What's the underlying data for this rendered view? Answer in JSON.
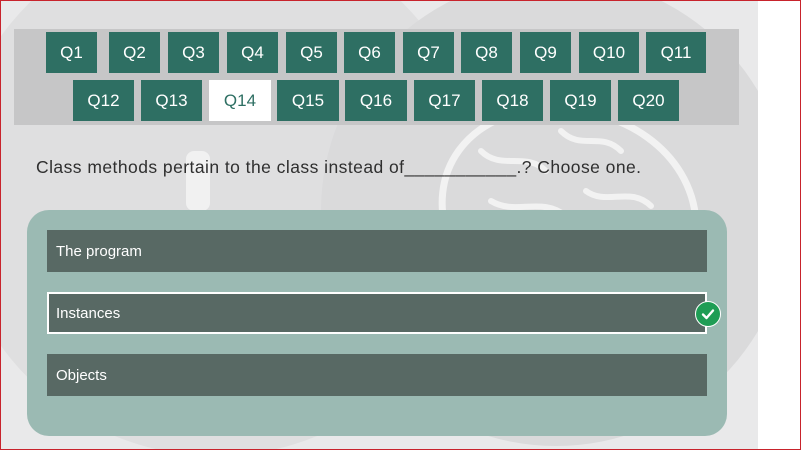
{
  "nav": {
    "row1": [
      "Q1",
      "Q2",
      "Q3",
      "Q4",
      "Q5",
      "Q6",
      "Q7",
      "Q8",
      "Q9",
      "Q10",
      "Q11"
    ],
    "row2": [
      "Q12",
      "Q13",
      "Q14",
      "Q15",
      "Q16",
      "Q17",
      "Q18",
      "Q19",
      "Q20"
    ],
    "active": "Q14"
  },
  "question": {
    "text": "Class methods pertain to the class instead of___________.? Choose one."
  },
  "answers": {
    "options": [
      {
        "label": "The program",
        "selected": false
      },
      {
        "label": "Instances",
        "selected": true
      },
      {
        "label": "Objects",
        "selected": false
      }
    ]
  },
  "colors": {
    "button": "#2e6f63",
    "active_button": "#ffffff",
    "answer_panel": "#9bbab3",
    "option": "#586964",
    "check": "#1f9d55"
  },
  "icons": {
    "check": "check-circle-icon",
    "background": "brain-illustration-icon"
  }
}
